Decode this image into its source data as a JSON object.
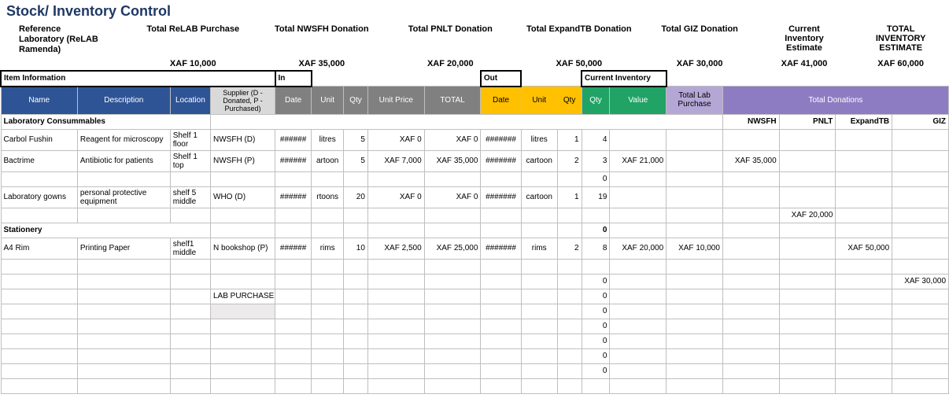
{
  "title": "Stock/ Inventory Control",
  "org": {
    "l1": "Reference",
    "l2": "Laboratory (ReLAB",
    "l3": "Ramenda)"
  },
  "totals": {
    "relab": {
      "label": "Total ReLAB Purchase",
      "value": "XAF 10,000"
    },
    "nwsfh": {
      "label": "Total NWSFH Donation",
      "value": "XAF 35,000"
    },
    "pnlt": {
      "label": "Total PNLT Donation",
      "value": "XAF 20,000"
    },
    "expand": {
      "label": "Total ExpandTB Donation",
      "value": "XAF 50,000"
    },
    "giz": {
      "label": "Total GIZ Donation",
      "value": "XAF 30,000"
    },
    "curInv": {
      "label1": "Current",
      "label2": "Inventory",
      "label3": "Estimate",
      "value": "XAF 41,000"
    },
    "totInv": {
      "label1": "TOTAL",
      "label2": "INVENTORY",
      "label3": "ESTIMATE",
      "value": "XAF 60,000"
    }
  },
  "bands": {
    "itemInfo": "Item Information",
    "in": "In",
    "out": "Out",
    "curInv": "Current Inventory",
    "totalDon": "Total Donations",
    "totalLabPurch": "Total Lab Purchase"
  },
  "cols": {
    "name": "Name",
    "desc": "Description",
    "loc": "Location",
    "supplier": "Supplier (D - Donated, P - Purchased)",
    "dateIn": "Date",
    "unitIn": "Unit",
    "qtyIn": "Qty",
    "unitPrice": "Unit Price",
    "total": "TOTAL",
    "dateOut": "Date",
    "unitOut": "Unit",
    "qtyOut": "Qty",
    "ciQty": "Qty",
    "ciValue": "Value"
  },
  "donors": {
    "nwsfh": "NWSFH",
    "pnlt": "PNLT",
    "expand": "ExpandTB",
    "giz": "GIZ"
  },
  "cats": {
    "cons": "Laboratory Consummables",
    "stat": "Stationery"
  },
  "labpurch": "LAB PURCHASE",
  "rows": [
    {
      "name": "Carbol Fushin",
      "desc": "Reagent for microscopy",
      "loc": "Shelf 1 floor",
      "sup": "NWSFH (D)",
      "dateIn": "######",
      "unitIn": "litres",
      "qtyIn": "5",
      "uprice": "XAF 0",
      "tot": "XAF 0",
      "dateOut": "#######",
      "unitOut": "litres",
      "qtyOut": "1",
      "ciQty": "4",
      "ciVal": "",
      "lab": "",
      "nwsfh": "",
      "pnlt": "",
      "expand": "",
      "giz": ""
    },
    {
      "name": "Bactrime",
      "desc": "Antibiotic for patients",
      "loc": "Shelf 1 top",
      "sup": "NWSFH (P)",
      "dateIn": "######",
      "unitIn": "artoon",
      "qtyIn": "5",
      "uprice": "XAF 7,000",
      "tot": "XAF 35,000",
      "dateOut": "#######",
      "unitOut": "cartoon",
      "qtyOut": "2",
      "ciQty": "3",
      "ciVal": "XAF 21,000",
      "lab": "",
      "nwsfh": "XAF 35,000",
      "pnlt": "",
      "expand": "",
      "giz": ""
    },
    {
      "name": "",
      "desc": "",
      "loc": "",
      "sup": "",
      "dateIn": "",
      "unitIn": "",
      "qtyIn": "",
      "uprice": "",
      "tot": "",
      "dateOut": "",
      "unitOut": "",
      "qtyOut": "",
      "ciQty": "0",
      "ciVal": "",
      "lab": "",
      "nwsfh": "",
      "pnlt": "",
      "expand": "",
      "giz": ""
    },
    {
      "name": "Laboratory gowns",
      "desc": "personal protective equipment",
      "loc": "shelf 5 middle",
      "sup": "WHO (D)",
      "dateIn": "######",
      "unitIn": "rtoons",
      "qtyIn": "20",
      "uprice": "XAF 0",
      "tot": "XAF 0",
      "dateOut": "#######",
      "unitOut": "cartoon",
      "qtyOut": "1",
      "ciQty": "19",
      "ciVal": "",
      "lab": "",
      "nwsfh": "",
      "pnlt": "",
      "expand": "",
      "giz": ""
    }
  ],
  "pnltLine": {
    "pnlt": "XAF 20,000"
  },
  "statRows": [
    {
      "name": "A4 Rim",
      "desc": "Printing Paper",
      "loc": "shelf1 middle",
      "sup": "N bookshop (P)",
      "dateIn": "######",
      "unitIn": "rims",
      "qtyIn": "10",
      "uprice": "XAF 2,500",
      "tot": "XAF 25,000",
      "dateOut": "#######",
      "unitOut": "rims",
      "qtyOut": "2",
      "ciQty": "8",
      "ciVal": "XAF 20,000",
      "lab": "XAF 10,000",
      "nwsfh": "",
      "pnlt": "",
      "expand": "XAF 50,000",
      "giz": ""
    }
  ],
  "gizLine": {
    "ciQty": "0",
    "giz": "XAF 30,000"
  },
  "zeroRows": [
    "0",
    "0",
    "0",
    "0",
    "0",
    "0"
  ]
}
